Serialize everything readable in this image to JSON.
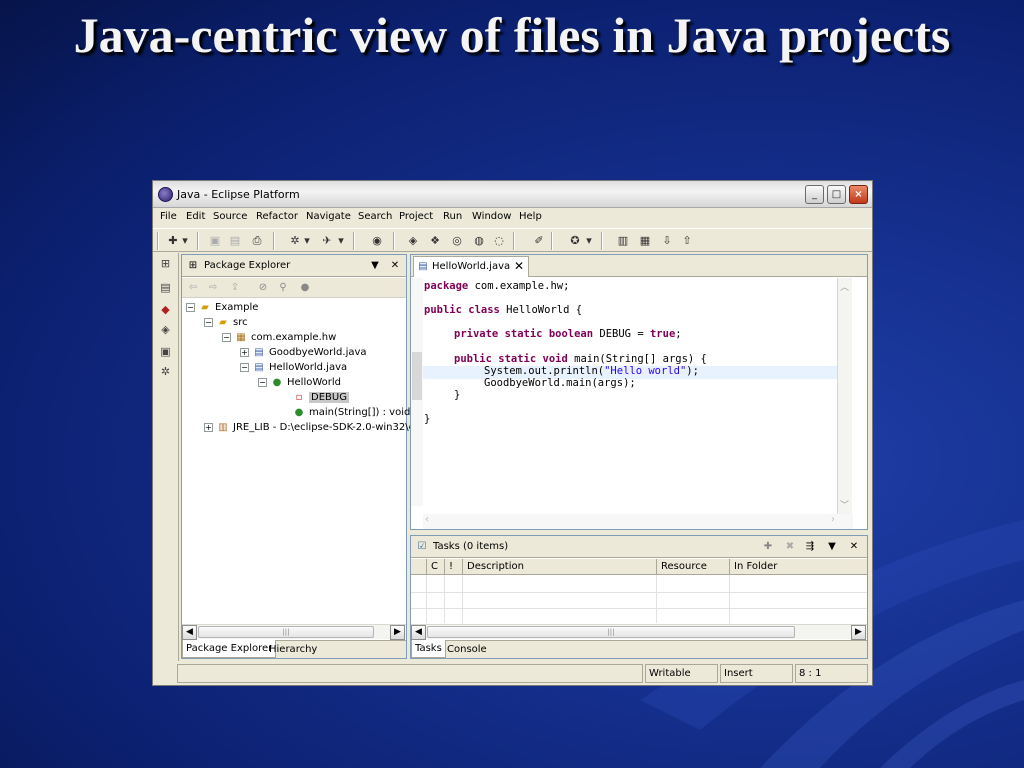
{
  "slide": {
    "title": "Java-centric view of files in Java projects"
  },
  "window": {
    "title": "Java - Eclipse Platform",
    "controls": [
      "_",
      "□",
      "×"
    ]
  },
  "menu": [
    "File",
    "Edit",
    "Source",
    "Refactor",
    "Navigate",
    "Search",
    "Project",
    "Run",
    "Window",
    "Help"
  ],
  "left_pane": {
    "title": "Package Explorer",
    "tree": {
      "project": "Example",
      "src": "src",
      "package": "com.example.hw",
      "file1": "GoodbyeWorld.java",
      "file2": "HelloWorld.java",
      "class": "HelloWorld",
      "field": "DEBUG",
      "method": "main(String[]) : void",
      "jre": "JRE_LIB - D:\\eclipse-SDK-2.0-win32\\e"
    },
    "tabs": [
      "Package Explorer",
      "Hierarchy"
    ]
  },
  "editor": {
    "tab": "HelloWorld.java",
    "code": {
      "l1_kw": "package",
      "l1_rest": " com.example.hw;",
      "l2_kw": "public class",
      "l2_rest": " HelloWorld {",
      "l3_kw": "private static boolean",
      "l3_rest": " DEBUG = ",
      "l3_kw2": "true",
      "l3_end": ";",
      "l4_kw": "public static void",
      "l4_rest": " main(String[] args) {",
      "l5_pre": "System.out.println(",
      "l5_str": "\"Hello world\"",
      "l5_end": ");",
      "l6": "GoodbyeWorld.main(args);",
      "l7": "}",
      "l8": "}"
    }
  },
  "tasks": {
    "title": "Tasks (0 items)",
    "columns": [
      "C",
      "!",
      "Description",
      "Resource",
      "In Folder"
    ],
    "tabs": [
      "Tasks",
      "Console"
    ]
  },
  "status": {
    "writable": "Writable",
    "mode": "Insert",
    "position": "8 : 1"
  },
  "colors": {
    "keyword": "#7f0055",
    "string": "#2a00ff",
    "line_highlight": "#e8f2fe"
  }
}
